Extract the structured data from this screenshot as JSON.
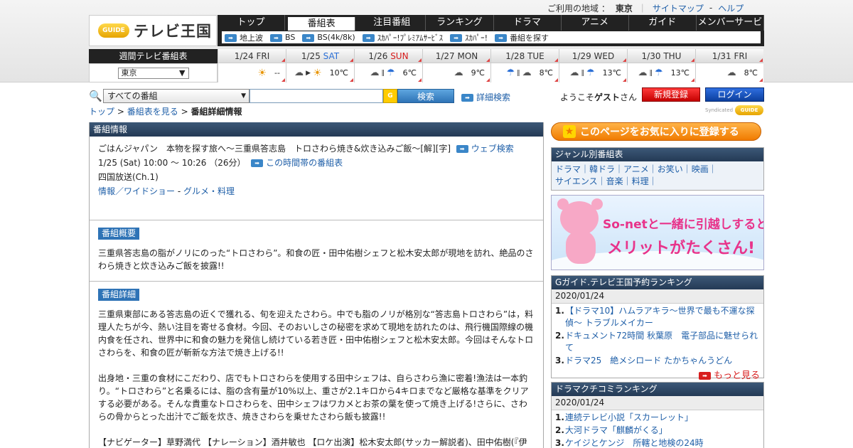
{
  "header": {
    "region_label": "ご利用の地域 ：",
    "region_value": "東京",
    "sitemap": "サイトマップ",
    "dash": "-",
    "help": "ヘルプ",
    "logo_text": "テレビ王国",
    "logo_badge": "GUIDE"
  },
  "nav": {
    "tabs": [
      "トップ",
      "番組表",
      "注目番組",
      "ランキング",
      "ドラマ",
      "アニメ",
      "ガイド",
      "メンバーサービス"
    ],
    "active_tab": "番組表",
    "sub": [
      "地上波",
      "BS",
      "BS(4k/8k)",
      "ｽｶﾊﾟｰ!ﾌﾟﾚﾐｱﾑｻｰﾋﾞｽ",
      "ｽｶﾊﾟｰ!",
      "番組を探す"
    ]
  },
  "weekly": {
    "title": "週間テレビ番組表",
    "region": "東京",
    "days": [
      {
        "date": "1/24",
        "dow": "FRI",
        "kind": "",
        "weather": [
          "sun"
        ],
        "temp": "--"
      },
      {
        "date": "1/25",
        "dow": "SAT",
        "kind": "sat",
        "weather": [
          "cloud",
          "to",
          "sun"
        ],
        "temp": "10℃"
      },
      {
        "date": "1/26",
        "dow": "SUN",
        "kind": "sun",
        "weather": [
          "cloud",
          "or",
          "umbrella"
        ],
        "temp": "6℃"
      },
      {
        "date": "1/27",
        "dow": "MON",
        "kind": "",
        "weather": [
          "cloud"
        ],
        "temp": "9℃"
      },
      {
        "date": "1/28",
        "dow": "TUE",
        "kind": "",
        "weather": [
          "umbrella",
          "or",
          "cloud"
        ],
        "temp": "8℃"
      },
      {
        "date": "1/29",
        "dow": "WED",
        "kind": "",
        "weather": [
          "cloud",
          "or",
          "umbrella"
        ],
        "temp": "13℃"
      },
      {
        "date": "1/30",
        "dow": "THU",
        "kind": "",
        "weather": [
          "cloud",
          "or",
          "umbrella"
        ],
        "temp": "13℃"
      },
      {
        "date": "1/31",
        "dow": "FRI",
        "kind": "",
        "weather": [
          "cloud"
        ],
        "temp": "8℃"
      }
    ]
  },
  "search": {
    "category": "すべての番組",
    "query": "",
    "button": "検索",
    "advanced": "詳細検索",
    "g_badge": "G"
  },
  "user": {
    "welcome_prefix": "ようこそ",
    "welcome_name": "ゲスト",
    "welcome_suffix": "さん",
    "register": "新規登録",
    "login": "ログイン",
    "syndicated": "Syndicated",
    "syn_badge": "GUIDE"
  },
  "breadcrumb": {
    "top": "トップ",
    "sep": ">",
    "schedule": "番組表を見る",
    "current": "番組詳細情報"
  },
  "program": {
    "section_title": "番組情報",
    "title": "ごはんジャパン　本物を探す旅へ～三重県答志島　トロさわら焼き&炊き込みご飯～[解][字]",
    "web_search": "ウェブ検索",
    "time": "1/25 (Sat) 10:00 ～ 10:26 （26分）",
    "time_schedule": "この時間帯の番組表",
    "channel": "四国放送(Ch.1)",
    "genre_main": "情報／ワイドショー",
    "genre_sep": " - ",
    "genre_sub": "グルメ・料理",
    "overview_label": "番組概要",
    "overview": "三重県答志島の脂がノリにのった“トロさわら”。和食の匠・田中佑樹シェフと松木安太郎が現地を訪れ、絶品のさわら焼きと炊き込みご飯を披露!!",
    "detail_label": "番組詳細",
    "detail_p1": "三重県東部にある答志島の近くで獲れる、旬を迎えたさわら。中でも脂のノリが格別な“答志島トロさわら”は，料理人たちが今、熱い注目を寄せる食材。今回、そのおいしさの秘密を求めて現地を訪れたのは、飛行機国際線の機内食を任され、世界中に和食の魅力を発信し続けている若き匠・田中佑樹シェフと松木安太郎。今回はそんなトロさわらを、和食の匠が斬新な方法で焼き上げる!!",
    "detail_p2": "出身地・三重の食材にこだわり、店でもトロさわらを使用する田中シェフは、自らさわら漁に密着!漁法は一本釣り。“トロさわら”と名乗るには、脂の含有量が10%以上、重さが2.1キロから4キロまでなど厳格な基準をクリアする必要がある。そんな貴重なトロさわらを、田中シェフはワカメとお茶の葉を使って焼き上げる!さらに、さわらの骨からとった出汁でご飯を炊き、焼きさわらを乗せたさわら飯も披露!!",
    "detail_p3": "【ナビゲーター】草野満代 【ナレーション】酒井敏也 【ロケ出演】松木安太郎(サッカー解説者)、田中佑樹(『伊勢すえよし』主人)"
  },
  "sidebar": {
    "favorite": "このページをお気に入りに登録する",
    "genre_title": "ジャンル別番組表",
    "genre_line1": "ドラマ｜韓ドラ｜アニメ｜お笑い｜映画｜",
    "genre_line2": "サイエンス｜音楽｜料理｜",
    "banner_l1": "So-netと一緒に引越しすると",
    "banner_l2": "メリットがたくさん!",
    "rank1_title": "Gガイド.テレビ王国予約ランキング",
    "rank1_date": "2020/01/24",
    "rank1_items": [
      "【ドラマ10】ハムラアキラ〜世界で最も不運な探偵〜 トラブルメイカー",
      "ドキュメント72時間 秋葉原　電子部品に魅せられて",
      "ドラマ25　絶メシロード たかちゃんうどん"
    ],
    "more": "もっと見る",
    "rank2_title": "ドラマクチコミランキング",
    "rank2_date": "2020/01/24",
    "rank2_items": [
      "連続テレビ小説「スカーレット」",
      "大河ドラマ「麒麟がくる」",
      "ケイジとケンジ　所轄と地検の24時"
    ]
  }
}
